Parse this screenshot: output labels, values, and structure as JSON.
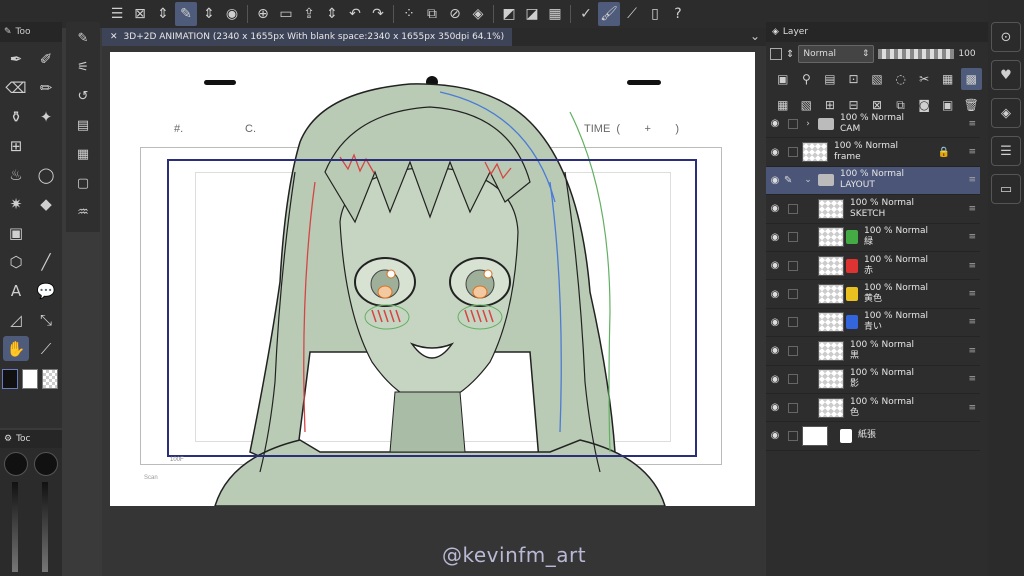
{
  "document_tab": {
    "title": "3D+2D ANIMATION (2340 x 1655px With blank space:2340 x 1655px 350dpi 64.1%)"
  },
  "tool_panel": {
    "header": "Too"
  },
  "color_panel": {
    "header": "Toc"
  },
  "layer_panel": {
    "header": "Layer",
    "blend_mode": "Normal",
    "opacity": "100",
    "layers": [
      {
        "opacity": "100 %",
        "mode": "Normal",
        "name": "CAM",
        "kind": "folder",
        "indent": 1
      },
      {
        "opacity": "100 %",
        "mode": "Normal",
        "name": "frame",
        "kind": "layer",
        "locked": true,
        "indent": 0
      },
      {
        "opacity": "100 %",
        "mode": "Normal",
        "name": "LAYOUT",
        "kind": "folder-open",
        "selected": true,
        "indent": 1
      },
      {
        "opacity": "100 %",
        "mode": "Normal",
        "name": "SKETCH",
        "kind": "layer",
        "indent": 2
      },
      {
        "opacity": "100 %",
        "mode": "Normal",
        "name": "緑",
        "kind": "color",
        "color": "#44aa44",
        "indent": 2
      },
      {
        "opacity": "100 %",
        "mode": "Normal",
        "name": "赤",
        "kind": "color",
        "color": "#dd3333",
        "indent": 2
      },
      {
        "opacity": "100 %",
        "mode": "Normal",
        "name": "黄色",
        "kind": "color",
        "color": "#e8c020",
        "indent": 2
      },
      {
        "opacity": "100 %",
        "mode": "Normal",
        "name": "青い",
        "kind": "color",
        "color": "#3366dd",
        "indent": 2
      },
      {
        "opacity": "100 %",
        "mode": "Normal",
        "name": "黒",
        "kind": "layer",
        "indent": 2
      },
      {
        "opacity": "100 %",
        "mode": "Normal",
        "name": "影",
        "kind": "layer",
        "indent": 2
      },
      {
        "opacity": "100 %",
        "mode": "Normal",
        "name": "色",
        "kind": "layer",
        "indent": 2
      },
      {
        "opacity": "",
        "mode": "",
        "name": "紙張",
        "kind": "paper",
        "indent": 0
      }
    ]
  },
  "canvas": {
    "cut_label": "#.",
    "scene_label": "C.",
    "time_label": "TIME  (        +        )",
    "frame_label": "100F",
    "scan_label": "Scan"
  },
  "watermark": "@kevinfm_art",
  "colors": {
    "accent": "#4f5b7a",
    "frame_line": "#2b2e7a",
    "skin": "#b9cbb5"
  }
}
